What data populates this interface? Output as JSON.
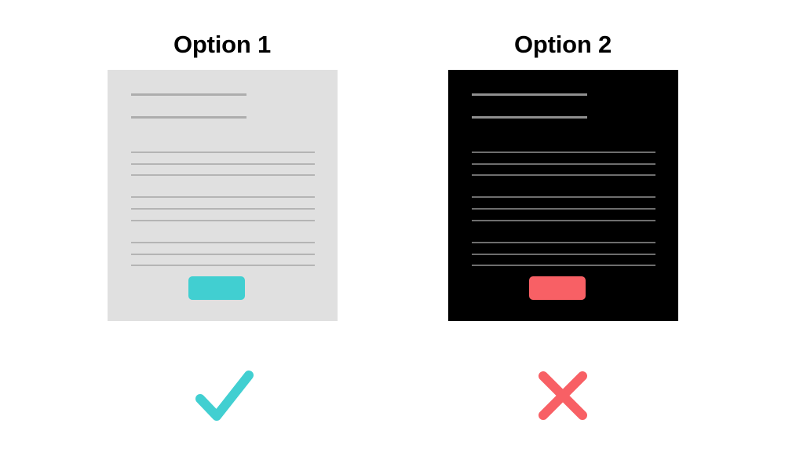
{
  "background_color": "#ffffff",
  "comparison": {
    "options": [
      {
        "id": "option-1",
        "title": "Option 1",
        "verdict": "check",
        "verdict_label": "approved",
        "panel": {
          "style": "light",
          "background_color": "#e0e0e0",
          "header_line_color": "#adadad",
          "body_line_color": "#b4b4b4",
          "header_lines": 2,
          "body_lines": 9,
          "body_line_groups": 3,
          "button": {
            "color": "#41cfd1",
            "label": "",
            "name": "primary-action-button"
          }
        },
        "verdict_color": "#41cfd1"
      },
      {
        "id": "option-2",
        "title": "Option 2",
        "verdict": "cross",
        "verdict_label": "rejected",
        "panel": {
          "style": "dark",
          "background_color": "#000000",
          "header_line_color": "#8f8f8f",
          "body_line_color": "#6e6e6e",
          "header_lines": 2,
          "body_lines": 9,
          "body_line_groups": 3,
          "button": {
            "color": "#f86065",
            "label": "",
            "name": "primary-action-button"
          }
        },
        "verdict_color": "#f86065"
      }
    ],
    "line_layout": {
      "header_y": [
        30,
        59
      ],
      "body_y": [
        104,
        119,
        133,
        161,
        176,
        191,
        219,
        234,
        248
      ]
    }
  }
}
